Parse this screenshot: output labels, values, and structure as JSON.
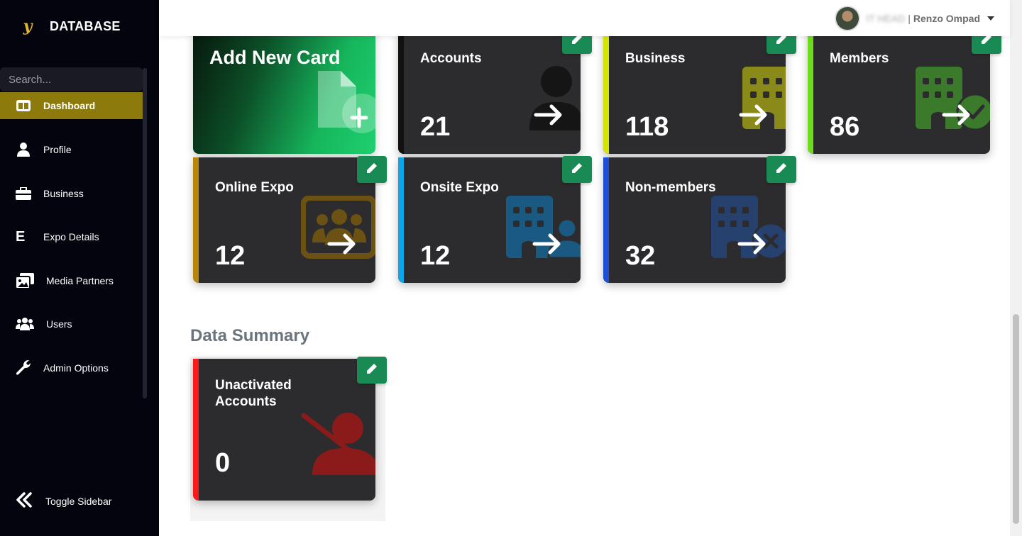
{
  "app": {
    "brand": "DATABASE",
    "logo_letter": "y"
  },
  "sidebar": {
    "search_placeholder": "Search...",
    "items": [
      {
        "label": "Dashboard",
        "icon": "columns-icon",
        "active": true
      },
      {
        "label": "Profile",
        "icon": "user-icon"
      },
      {
        "label": "Business",
        "icon": "briefcase-icon"
      },
      {
        "label": "Expo Details",
        "icon": "letter-e-icon",
        "icon_text": "E"
      },
      {
        "label": "Media Partners",
        "icon": "images-icon"
      },
      {
        "label": "Users",
        "icon": "users-icon"
      },
      {
        "label": "Admin Options",
        "icon": "wrench-icon"
      }
    ],
    "toggle_label": "Toggle Sidebar"
  },
  "header": {
    "user_role": "IT HEAD",
    "user_separator": "|",
    "user_name": "Renzo Ompad"
  },
  "cards": {
    "add_new": {
      "label": "Add New Card"
    },
    "accounts": {
      "title": "Accounts",
      "value": "21",
      "accent": "#111111",
      "icon": "user-icon"
    },
    "business": {
      "title": "Business",
      "value": "118",
      "accent": "#d4e600",
      "icon": "building-icon"
    },
    "members": {
      "title": "Members",
      "value": "86",
      "accent": "#6cdc1c",
      "icon": "building-check-icon"
    },
    "online_expo": {
      "title": "Online Expo",
      "value": "12",
      "accent": "#b8860b",
      "icon": "screen-users-icon"
    },
    "onsite_expo": {
      "title": "Onsite Expo",
      "value": "12",
      "accent": "#0ea5e9",
      "icon": "building-user-icon"
    },
    "non_members": {
      "title": "Non-members",
      "value": "32",
      "accent": "#1d4ed8",
      "icon": "building-xmark-icon"
    }
  },
  "data_summary": {
    "heading": "Data Summary",
    "unactivated": {
      "title_line1": "Unactivated",
      "title_line2": "Accounts",
      "value": "0",
      "accent": "#ff1a1a",
      "icon": "user-slash-icon"
    }
  }
}
